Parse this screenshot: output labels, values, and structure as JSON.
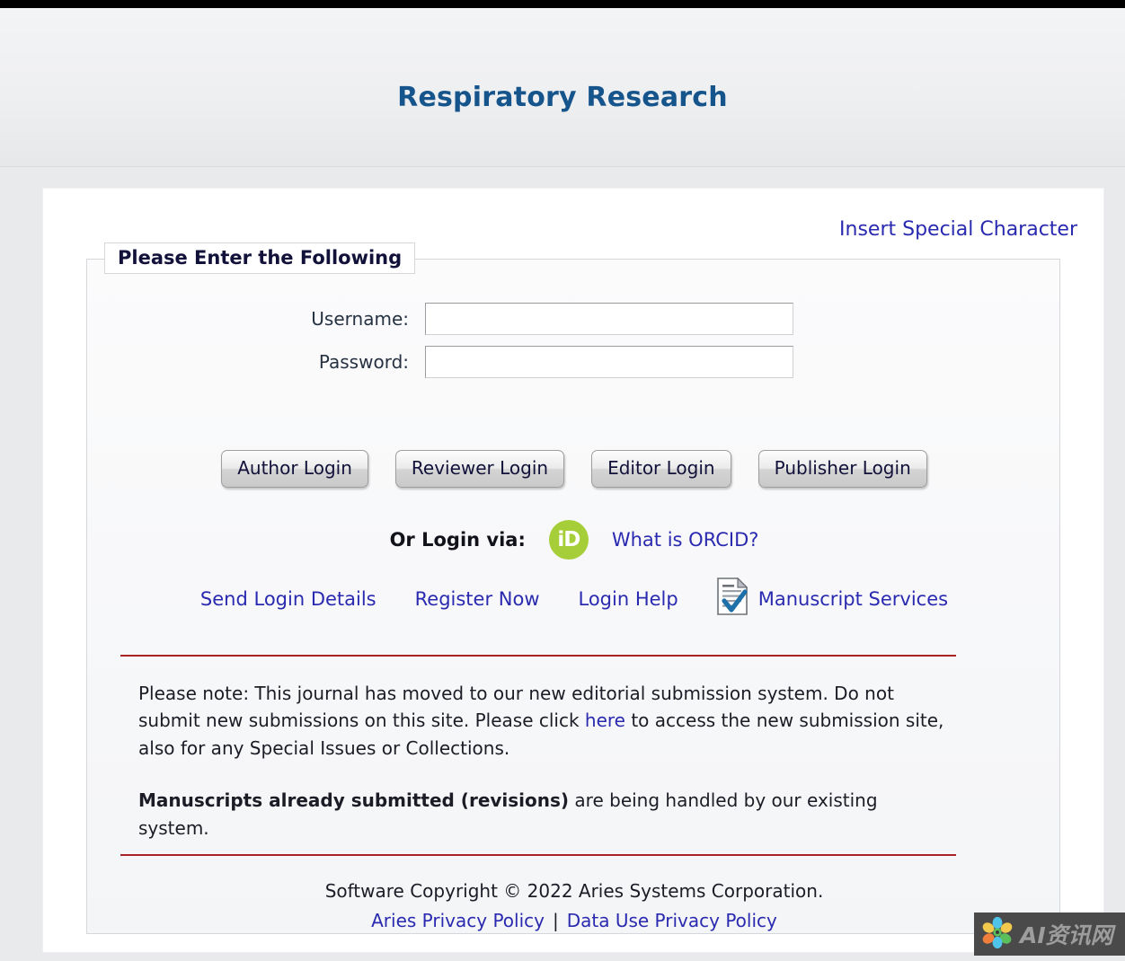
{
  "header": {
    "journal_title": "Respiratory Research"
  },
  "panel": {
    "special_character_link": "Insert Special Character",
    "fieldset_legend": "Please Enter the Following",
    "credentials": {
      "username_label": "Username:",
      "username_value": "",
      "username_placeholder": "",
      "password_label": "Password:",
      "password_value": "",
      "password_placeholder": ""
    },
    "login_buttons": [
      {
        "label": "Author Login"
      },
      {
        "label": "Reviewer Login"
      },
      {
        "label": "Editor Login"
      },
      {
        "label": "Publisher Login"
      }
    ],
    "orcid": {
      "or_login_via_label": "Or Login via:",
      "icon_text": "iD",
      "icon_name": "orcid-icon",
      "icon_color": "#A6CE39",
      "what_is_orcid_link": "What is ORCID?"
    },
    "helper_links": [
      {
        "label": "Send Login Details",
        "name": "send-login-details-link"
      },
      {
        "label": "Register Now",
        "name": "register-now-link"
      },
      {
        "label": "Login Help",
        "name": "login-help-link"
      },
      {
        "label": "Manuscript Services",
        "name": "manuscript-services-link"
      }
    ],
    "notes": {
      "paragraph1_part1": "Please note: This journal has moved to our new editorial submission system. Do not submit new submissions on this site. Please click ",
      "paragraph1_link": "here",
      "paragraph1_part2": " to access the new submission site, also for any Special Issues or Collections.",
      "paragraph2_bold": "Manuscripts already submitted (revisions)",
      "paragraph2_rest": " are being handled by our existing system."
    },
    "footer": {
      "copyright": "Software Copyright © 2022 Aries Systems Corporation.",
      "privacy_policy_link": "Aries Privacy Policy",
      "separator": "|",
      "data_use_link": "Data Use Privacy Policy"
    }
  },
  "watermark": {
    "text": "AI资讯网"
  },
  "colors": {
    "title_blue": "#16548C",
    "link_blue": "#2A2AB0",
    "rule_red": "#AB2222",
    "orcid_green": "#A6CE39"
  }
}
